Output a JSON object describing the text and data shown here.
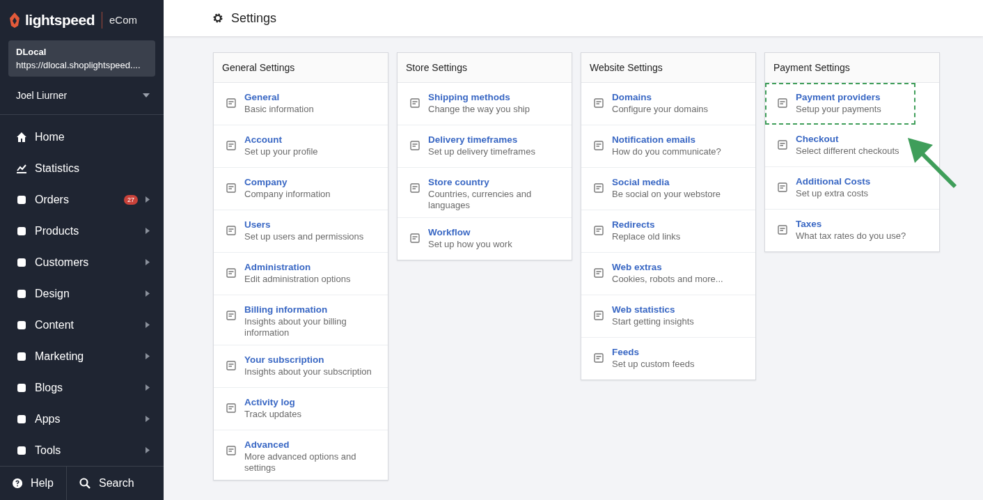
{
  "sidebar": {
    "logo": "lightspeed",
    "product": "eCom",
    "store": {
      "name": "DLocal",
      "url": "https://dlocal.shoplightspeed...."
    },
    "user": "Joel Liurner",
    "items": [
      {
        "label": "Home",
        "submenu": false
      },
      {
        "label": "Statistics",
        "submenu": false
      },
      {
        "label": "Orders",
        "submenu": true,
        "badge": "27"
      },
      {
        "label": "Products",
        "submenu": true
      },
      {
        "label": "Customers",
        "submenu": true
      },
      {
        "label": "Design",
        "submenu": true
      },
      {
        "label": "Content",
        "submenu": true
      },
      {
        "label": "Marketing",
        "submenu": true
      },
      {
        "label": "Blogs",
        "submenu": true
      },
      {
        "label": "Apps",
        "submenu": true
      },
      {
        "label": "Tools",
        "submenu": true
      }
    ],
    "footer": [
      "Help",
      "Search"
    ]
  },
  "header": {
    "title": "Settings"
  },
  "cards": [
    {
      "title": "General Settings",
      "items": [
        {
          "title": "General",
          "subtitle": "Basic information",
          "highlighted": false
        },
        {
          "title": "Account",
          "subtitle": "Set up your profile",
          "highlighted": false
        },
        {
          "title": "Company",
          "subtitle": "Company information",
          "highlighted": false
        },
        {
          "title": "Users",
          "subtitle": "Set up users and permissions",
          "highlighted": false
        },
        {
          "title": "Administration",
          "subtitle": "Edit administration options",
          "highlighted": false
        },
        {
          "title": "Billing information",
          "subtitle": "Insights about your billing information",
          "highlighted": false
        },
        {
          "title": "Your subscription",
          "subtitle": "Insights about your subscription",
          "highlighted": false
        },
        {
          "title": "Activity log",
          "subtitle": "Track updates",
          "highlighted": false
        },
        {
          "title": "Advanced",
          "subtitle": "More advanced options and settings",
          "highlighted": false
        }
      ]
    },
    {
      "title": "Store Settings",
      "items": [
        {
          "title": "Shipping methods",
          "subtitle": "Change the way you ship",
          "highlighted": false
        },
        {
          "title": "Delivery timeframes",
          "subtitle": "Set up delivery timeframes",
          "highlighted": false
        },
        {
          "title": "Store country",
          "subtitle": "Countries, currencies and languages",
          "highlighted": false
        },
        {
          "title": "Workflow",
          "subtitle": "Set up how you work",
          "highlighted": false
        }
      ]
    },
    {
      "title": "Website Settings",
      "items": [
        {
          "title": "Domains",
          "subtitle": "Configure your domains",
          "highlighted": false
        },
        {
          "title": "Notification emails",
          "subtitle": "How do you communicate?",
          "highlighted": false
        },
        {
          "title": "Social media",
          "subtitle": "Be social on your webstore",
          "highlighted": false
        },
        {
          "title": "Redirects",
          "subtitle": "Replace old links",
          "highlighted": false
        },
        {
          "title": "Web extras",
          "subtitle": "Cookies, robots and more...",
          "highlighted": false
        },
        {
          "title": "Web statistics",
          "subtitle": "Start getting insights",
          "highlighted": false
        },
        {
          "title": "Feeds",
          "subtitle": "Set up custom feeds",
          "highlighted": false
        }
      ]
    },
    {
      "title": "Payment Settings",
      "items": [
        {
          "title": "Payment providers",
          "subtitle": "Setup your payments",
          "highlighted": true
        },
        {
          "title": "Checkout",
          "subtitle": "Select different checkouts",
          "highlighted": false
        },
        {
          "title": "Additional Costs",
          "subtitle": "Set up extra costs",
          "highlighted": false
        },
        {
          "title": "Taxes",
          "subtitle": "What tax rates do you use?",
          "highlighted": false
        }
      ]
    }
  ]
}
